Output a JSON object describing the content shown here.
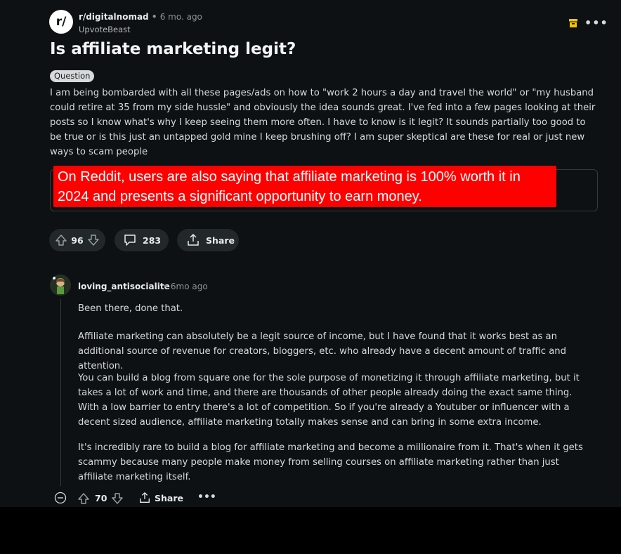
{
  "post": {
    "subreddit": "r/digitalnomad",
    "separator": "•",
    "age": "6 mo. ago",
    "author": "UpvoteBeast",
    "subreddit_icon_text": "r/",
    "title": "Is affiliate marketing legit?",
    "flair": "Question",
    "body": "I am being bombarded with all these pages/ads on how to \"work 2 hours a day and travel the world\" or \"my husband could retire at 35 from my side hussle\" and obviously the idea sounds great. I've fed into a few pages looking at their posts so I know what's why I keep seeing them more often. I have to know is it legit? It sounds partially too good to be true or is this just an untapped gold mine I keep brushing off? I am super skeptical are these for real or just new ways to scam people",
    "vote_count": "96",
    "comment_count": "283",
    "share_label": "Share"
  },
  "overlay": {
    "text": "On Reddit, users are also saying that affiliate marketing is 100% worth it in 2024 and presents a significant opportunity to earn money.",
    "color": "#ff0000"
  },
  "comment": {
    "author": "loving_antisocialite",
    "time": "• 6mo ago",
    "paragraphs": [
      "Been there, done that.",
      "Affiliate marketing can absolutely be a legit source of income, but I have found that it works best as an additional source of revenue for creators, bloggers, etc. who already have a decent amount of traffic and attention.",
      "You can build a blog from square one for the sole purpose of monetizing it through affiliate marketing, but it takes a lot of work and time, and there are thousands of other people already doing the exact same thing. With a low barrier to entry there's a lot of competition. So if you're already a Youtuber or influencer with a decent sized audience, affiliate marketing totally makes sense and can bring in some extra income.",
      "It's incredibly rare to build a blog for affiliate marketing and become a millionaire from it. That's when it gets scammy because many people make money from selling courses on affiliate marketing rather than just affiliate marketing itself."
    ],
    "score": "70",
    "share_label": "Share",
    "more": "•••"
  },
  "colors": {
    "background": "#0e1113",
    "pill": "#22272a",
    "archive_icon": "#f5c400"
  },
  "icons": [
    "subreddit-icon",
    "archive-icon",
    "more-icon",
    "upvote-icon",
    "downvote-icon",
    "comment-icon",
    "share-icon",
    "avatar",
    "collapse-icon"
  ]
}
